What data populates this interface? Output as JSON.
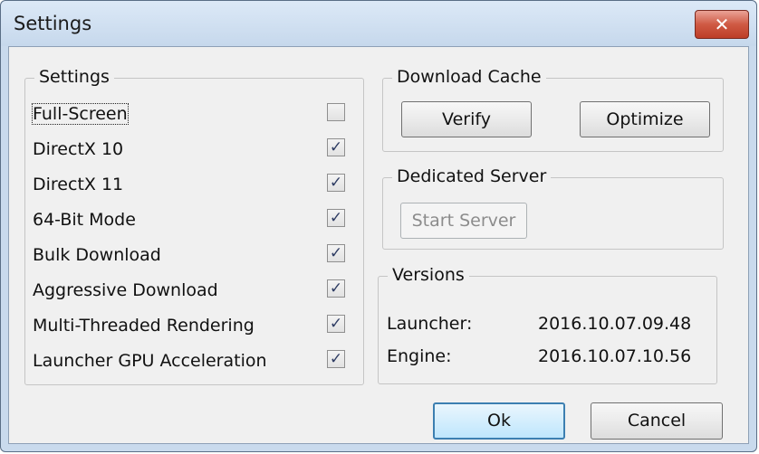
{
  "window": {
    "title": "Settings",
    "close_symbol": "✕"
  },
  "settings_group": {
    "legend": "Settings",
    "items": [
      {
        "label": "Full-Screen",
        "checked": false,
        "mark": ""
      },
      {
        "label": "DirectX 10",
        "checked": true,
        "mark": "✓"
      },
      {
        "label": "DirectX 11",
        "checked": true,
        "mark": "✓"
      },
      {
        "label": "64-Bit Mode",
        "checked": true,
        "mark": "✓"
      },
      {
        "label": "Bulk Download",
        "checked": true,
        "mark": "✓"
      },
      {
        "label": "Aggressive Download",
        "checked": true,
        "mark": "✓"
      },
      {
        "label": "Multi-Threaded Rendering",
        "checked": true,
        "mark": "✓"
      },
      {
        "label": "Launcher GPU Acceleration",
        "checked": true,
        "mark": "✓"
      }
    ]
  },
  "download_cache": {
    "legend": "Download Cache",
    "verify_label": "Verify",
    "optimize_label": "Optimize"
  },
  "dedicated_server": {
    "legend": "Dedicated Server",
    "start_label": "Start Server"
  },
  "versions": {
    "legend": "Versions",
    "launcher_label": "Launcher:",
    "launcher_value": "2016.10.07.09.48",
    "engine_label": "Engine:",
    "engine_value": "2016.10.07.10.56"
  },
  "footer": {
    "ok_label": "Ok",
    "cancel_label": "Cancel"
  },
  "icons": {
    "close": "close-icon",
    "check": "checkmark-icon"
  }
}
